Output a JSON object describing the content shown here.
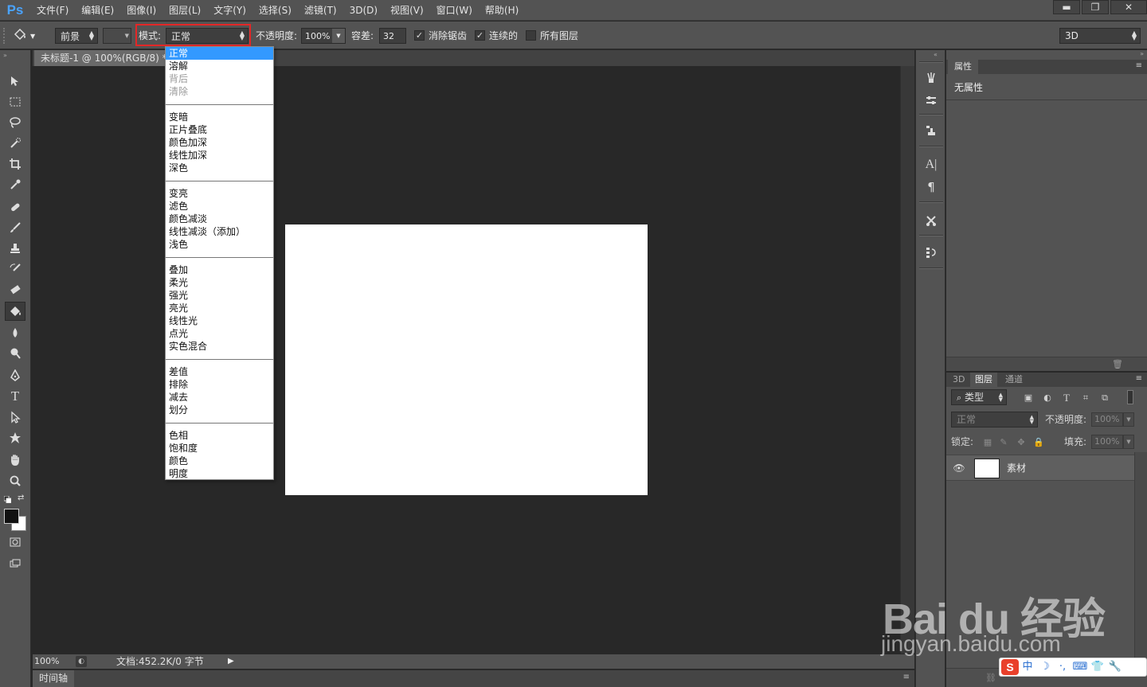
{
  "app": {
    "logo": "Ps"
  },
  "menu": [
    "文件(F)",
    "编辑(E)",
    "图像(I)",
    "图层(L)",
    "文字(Y)",
    "选择(S)",
    "滤镜(T)",
    "3D(D)",
    "视图(V)",
    "窗口(W)",
    "帮助(H)"
  ],
  "window_controls": {
    "minimize": "▬",
    "restore": "❐",
    "close": "✕"
  },
  "options": {
    "fill_source": "前景",
    "mode_label": "模式:",
    "mode_value": "正常",
    "opacity_label": "不透明度:",
    "opacity_value": "100%",
    "tolerance_label": "容差:",
    "tolerance_value": "32",
    "antialias_label": "消除锯齿",
    "antialias_checked": true,
    "contiguous_label": "连续的",
    "contiguous_checked": true,
    "all_layers_label": "所有图层",
    "all_layers_checked": false,
    "workspace": "3D"
  },
  "document": {
    "tab_label": "未标题-1 @ 100%(RGB/8) *",
    "zoom": "100%",
    "doc_info": "文档:452.2K/0 字节"
  },
  "timeline": {
    "tab_label": "时间轴"
  },
  "mode_dropdown": {
    "groups": [
      [
        {
          "label": "正常",
          "state": "selected"
        },
        {
          "label": "溶解",
          "state": "normal"
        },
        {
          "label": "背后",
          "state": "disabled"
        },
        {
          "label": "清除",
          "state": "disabled"
        }
      ],
      [
        {
          "label": "变暗",
          "state": "normal"
        },
        {
          "label": "正片叠底",
          "state": "normal"
        },
        {
          "label": "颜色加深",
          "state": "normal"
        },
        {
          "label": "线性加深",
          "state": "normal"
        },
        {
          "label": "深色",
          "state": "normal"
        }
      ],
      [
        {
          "label": "变亮",
          "state": "normal"
        },
        {
          "label": "滤色",
          "state": "normal"
        },
        {
          "label": "颜色减淡",
          "state": "normal"
        },
        {
          "label": "线性减淡（添加）",
          "state": "normal"
        },
        {
          "label": "浅色",
          "state": "normal"
        }
      ],
      [
        {
          "label": "叠加",
          "state": "normal"
        },
        {
          "label": "柔光",
          "state": "normal"
        },
        {
          "label": "强光",
          "state": "normal"
        },
        {
          "label": "亮光",
          "state": "normal"
        },
        {
          "label": "线性光",
          "state": "normal"
        },
        {
          "label": "点光",
          "state": "normal"
        },
        {
          "label": "实色混合",
          "state": "normal"
        }
      ],
      [
        {
          "label": "差值",
          "state": "normal"
        },
        {
          "label": "排除",
          "state": "normal"
        },
        {
          "label": "减去",
          "state": "normal"
        },
        {
          "label": "划分",
          "state": "normal"
        }
      ],
      [
        {
          "label": "色相",
          "state": "normal"
        },
        {
          "label": "饱和度",
          "state": "normal"
        },
        {
          "label": "颜色",
          "state": "normal"
        },
        {
          "label": "明度",
          "state": "normal"
        }
      ]
    ]
  },
  "properties_panel": {
    "tab": "属性",
    "content": "无属性"
  },
  "layers_panel": {
    "tabs": [
      "3D",
      "图层",
      "通道"
    ],
    "active_tab": "图层",
    "filter_kind": "类型",
    "blend_mode": "正常",
    "opacity_label": "不透明度:",
    "opacity_value": "100%",
    "lock_label": "锁定:",
    "fill_label": "填充:",
    "fill_value": "100%",
    "layers": [
      {
        "name": "素材",
        "visible": true
      }
    ]
  },
  "watermark": {
    "brand": "Bai du 经验",
    "url": "jingyan.baidu.com"
  },
  "ime_bar": {
    "logo": "S",
    "items": [
      "中",
      "☽",
      "·,",
      "⌨",
      "👕",
      "🔧"
    ]
  },
  "colors": {
    "accent_selected": "#3399ff",
    "highlight_box": "#e32727",
    "panel_bg": "#535353",
    "canvas_bg": "#282828"
  }
}
